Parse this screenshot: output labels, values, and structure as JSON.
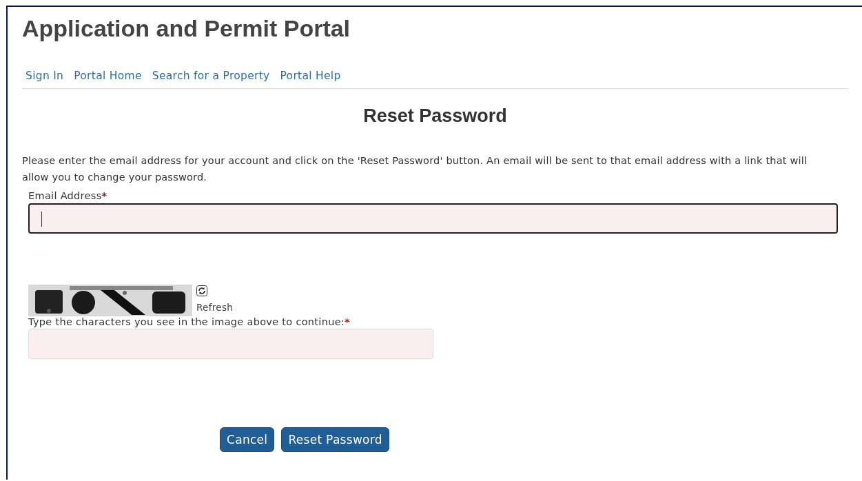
{
  "header": {
    "title": "Application and Permit Portal"
  },
  "nav": [
    {
      "label": "Sign In"
    },
    {
      "label": "Portal Home"
    },
    {
      "label": "Search for a Property"
    },
    {
      "label": "Portal Help"
    }
  ],
  "heading": "Reset Password",
  "instructions": "Please enter the email address for your account and click on the 'Reset Password' button. An email will be sent to that email address with a link that will allow you to change your password.",
  "email_field": {
    "label": "Email Address",
    "required_mark": "*",
    "focused": true
  },
  "captcha": {
    "refresh_label": "Refresh",
    "prompt": "Type the characters you see in the image above to continue:",
    "required_mark": "*",
    "focused": false
  },
  "buttons": [
    {
      "label": "Cancel"
    },
    {
      "label": "Reset Password"
    }
  ]
}
